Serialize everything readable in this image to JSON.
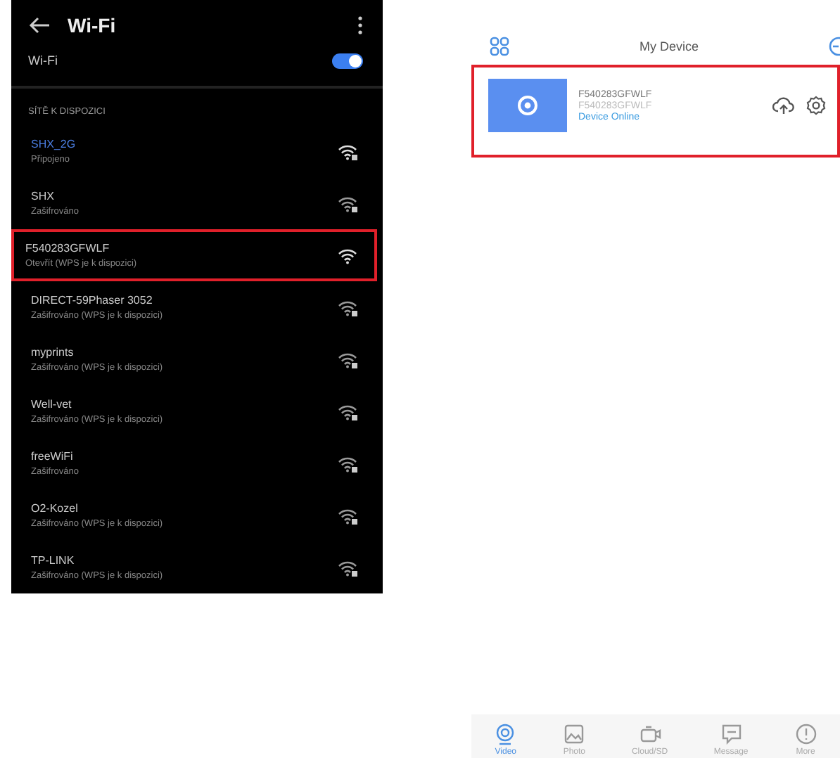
{
  "wifi_screen": {
    "title": "Wi-Fi",
    "toggle": {
      "label": "Wi-Fi",
      "on": true
    },
    "section_header": "SÍTĚ K DISPOZICI",
    "networks": [
      {
        "name": "SHX_2G",
        "status": "Připojeno",
        "connected": true,
        "secured": true,
        "highlighted": false
      },
      {
        "name": "SHX",
        "status": "Zašifrováno",
        "connected": false,
        "secured": true,
        "highlighted": false
      },
      {
        "name": "F540283GFWLF",
        "status": "Otevřít (WPS je k dispozici)",
        "connected": false,
        "secured": false,
        "highlighted": true
      },
      {
        "name": "DIRECT-59Phaser 3052",
        "status": "Zašifrováno (WPS je k dispozici)",
        "connected": false,
        "secured": true,
        "highlighted": false
      },
      {
        "name": "myprints",
        "status": "Zašifrováno (WPS je k dispozici)",
        "connected": false,
        "secured": true,
        "highlighted": false
      },
      {
        "name": "Well-vet",
        "status": "Zašifrováno (WPS je k dispozici)",
        "connected": false,
        "secured": true,
        "highlighted": false
      },
      {
        "name": "freeWiFi",
        "status": "Zašifrováno",
        "connected": false,
        "secured": true,
        "highlighted": false
      },
      {
        "name": "O2-Kozel",
        "status": "Zašifrováno (WPS je k dispozici)",
        "connected": false,
        "secured": true,
        "highlighted": false
      },
      {
        "name": "TP-LINK",
        "status": "Zašifrováno (WPS je k dispozici)",
        "connected": false,
        "secured": true,
        "highlighted": false
      }
    ]
  },
  "device_screen": {
    "title": "My Device",
    "device": {
      "name": "F540283GFWLF",
      "id": "F540283GFWLF",
      "status": "Device Online",
      "highlighted": true
    },
    "tabs": [
      {
        "label": "Video",
        "kind": "camera",
        "selected": true
      },
      {
        "label": "Photo",
        "kind": "photo",
        "selected": false
      },
      {
        "label": "Cloud/SD",
        "kind": "cloud",
        "selected": false
      },
      {
        "label": "Message",
        "kind": "message",
        "selected": false
      },
      {
        "label": "More",
        "kind": "more",
        "selected": false
      }
    ]
  }
}
